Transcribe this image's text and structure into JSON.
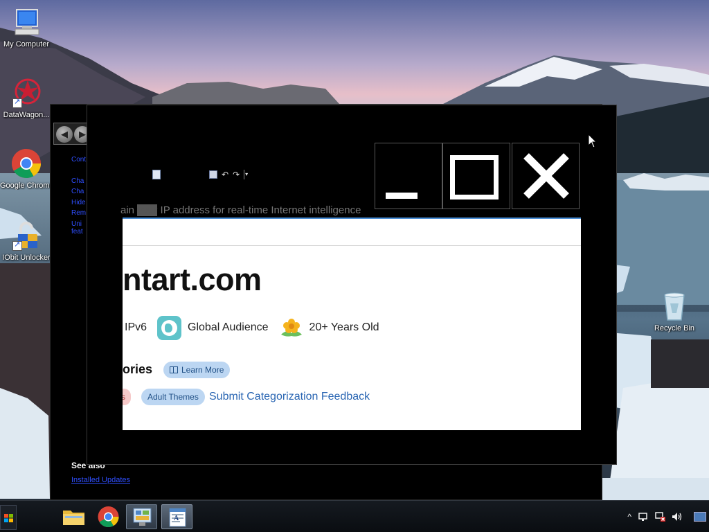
{
  "desktop": {
    "icons": [
      {
        "label": "My Computer",
        "icon": "computer-icon"
      },
      {
        "label": "DataWagon...",
        "icon": "datawagon-icon"
      },
      {
        "label": "Google Chrome",
        "icon": "chrome-icon"
      },
      {
        "label": "IObit Unlocker",
        "icon": "unlocker-icon"
      },
      {
        "label": "Recycle Bin",
        "icon": "recycle-bin-icon"
      }
    ]
  },
  "back_window": {
    "nav_back": "◀",
    "nav_forward": "▶",
    "links": [
      "Cont",
      "Cha",
      "Cha",
      "Hide",
      "Rem",
      "Uni",
      "feat"
    ],
    "see_also": "See also",
    "installed_updates": "Installed Updates"
  },
  "front_window": {
    "toolbar": {
      "undo": "↶",
      "redo": "↷",
      "dropdown": "▾"
    },
    "faded_text_start": "ain ",
    "faded_text_highlight": "your",
    "faded_text_end": " IP address for real-time Internet intelligence",
    "web": {
      "domain": "ntart.com",
      "facts": [
        {
          "label": "IPv6"
        },
        {
          "label": "Global Audience",
          "icon": "globe-icon"
        },
        {
          "label": "20+ Years Old",
          "icon": "flower-icon"
        }
      ],
      "categories_title": "ories",
      "learn_more": "Learn More",
      "chip_partial": "ks",
      "chip_adult": "Adult Themes",
      "feedback_link": "Submit Categorization Feedback"
    }
  },
  "taskbar": {
    "apps": [
      {
        "name": "file-explorer",
        "icon": "folder-icon"
      },
      {
        "name": "chrome",
        "icon": "chrome-icon"
      },
      {
        "name": "control-panel",
        "icon": "control-panel-icon"
      },
      {
        "name": "wordpad",
        "icon": "wordpad-icon"
      }
    ],
    "tray_expand": "^"
  },
  "colors": {
    "window_bg": "#000000",
    "link_blue": "#2f4fff",
    "chip_blue_bg": "#bcd6f2",
    "chip_pink_bg": "#f6c9c9",
    "feedback_link": "#2a66b3"
  }
}
